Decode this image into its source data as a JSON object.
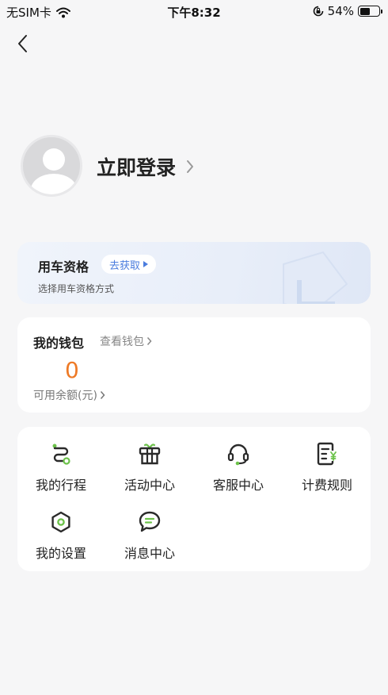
{
  "status_bar": {
    "carrier": "无SIM卡",
    "time": "下午8:32",
    "battery_percent": "54%",
    "battery_level": 0.54
  },
  "nav": {
    "back_icon": "chevron-left-icon"
  },
  "profile": {
    "login_label": "立即登录",
    "avatar_icon": "default-avatar-icon"
  },
  "eligibility": {
    "title": "用车资格",
    "action_label": "去获取",
    "subtitle": "选择用车资格方式"
  },
  "wallet": {
    "title": "我的钱包",
    "view_label": "查看钱包",
    "balance": "0",
    "balance_label": "可用余额(元)",
    "accent_color": "#ee7a26"
  },
  "menu": {
    "items": [
      {
        "label": "我的行程",
        "icon": "route-icon"
      },
      {
        "label": "活动中心",
        "icon": "gift-icon"
      },
      {
        "label": "客服中心",
        "icon": "headset-icon"
      },
      {
        "label": "计费规则",
        "icon": "billing-rules-icon"
      },
      {
        "label": "我的设置",
        "icon": "settings-icon"
      },
      {
        "label": "消息中心",
        "icon": "message-icon"
      }
    ],
    "icon_color": "#2a2a2a",
    "accent_color": "#6cc24a"
  }
}
